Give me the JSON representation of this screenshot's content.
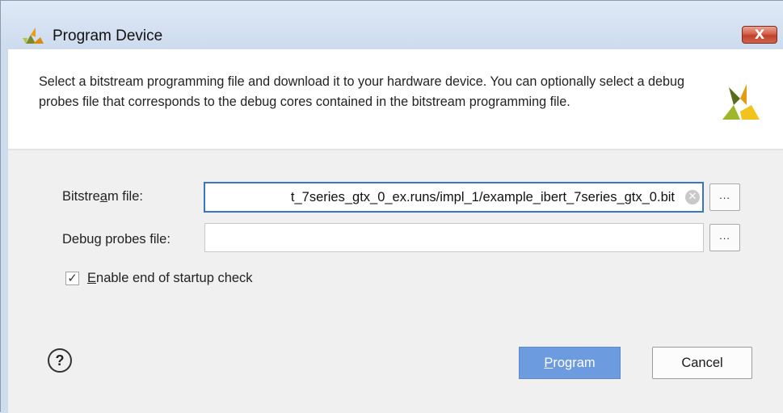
{
  "window": {
    "title": "Program Device",
    "close_label": "X"
  },
  "description": "Select a bitstream programming file and download it to your hardware device. You can optionally select a debug probes file that corresponds to the debug cores contained in the bitstream programming file.",
  "bitstream": {
    "label_pre": "Bitstre",
    "label_mnemonic": "a",
    "label_post": "m file:",
    "value": "t_7series_gtx_0_ex.runs/impl_1/example_ibert_7series_gtx_0.bit",
    "browse_label": "..."
  },
  "debug_probes": {
    "label_pre": "Debu",
    "label_mnemonic": "g",
    "label_post": " probes file:",
    "value": "",
    "browse_label": "..."
  },
  "startup_check": {
    "mnemonic": "E",
    "label_rest": "nable end of startup check",
    "checked": true
  },
  "help_label": "?",
  "buttons": {
    "program_mnemonic": "P",
    "program_rest": "rogram",
    "cancel": "Cancel"
  },
  "colors": {
    "accent": "#6d9be0",
    "focus_border": "#3a75c4",
    "close_red": "#c0422c"
  },
  "icons": {
    "title_logo": "vivado-logo-icon",
    "header_logo": "vivado-logo-icon",
    "clear": "clear-icon",
    "help": "help-icon"
  }
}
